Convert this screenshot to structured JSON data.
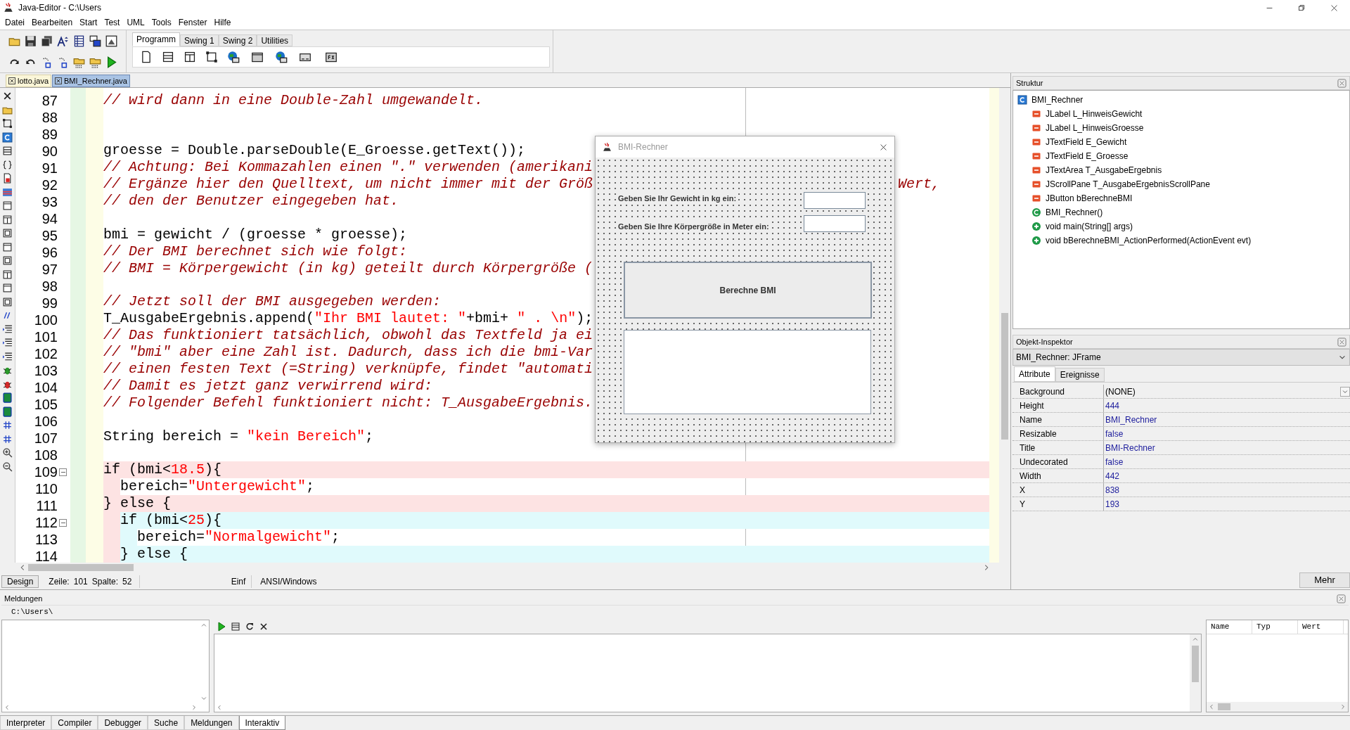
{
  "window": {
    "title": "Java-Editor - C:\\Users"
  },
  "menu": [
    "Datei",
    "Bearbeiten",
    "Start",
    "Test",
    "UML",
    "Tools",
    "Fenster",
    "Hilfe"
  ],
  "palette_tabs": [
    {
      "label": "Programm",
      "selected": true
    },
    {
      "label": "Swing 1",
      "selected": false
    },
    {
      "label": "Swing 2",
      "selected": false
    },
    {
      "label": "Utilities",
      "selected": false
    }
  ],
  "file_tabs": [
    {
      "label": "lotto.java",
      "selected": false
    },
    {
      "label": "BMI_Rechner.java",
      "selected": true
    }
  ],
  "editor": {
    "lines": [
      {
        "number": "87",
        "segments": [
          {
            "kind": "comment",
            "text": "// wird dann in eine Double-Zahl umgewandelt."
          }
        ]
      },
      {
        "number": "88"
      },
      {
        "number": "89"
      },
      {
        "number": "90",
        "segments": [
          {
            "kind": "plain",
            "text": "groesse = Double.parseDouble(E_Groesse.getText());"
          }
        ]
      },
      {
        "number": "91",
        "segments": [
          {
            "kind": "comment",
            "text": "// Achtung: Bei Kommazahlen einen \".\" verwenden (amerikani"
          }
        ]
      },
      {
        "number": "92",
        "segments": [
          {
            "kind": "comment",
            "text": "// Ergänze hier den Quelltext, um nicht immer mit der Größ"
          }
        ],
        "after_dialog": "Wert,"
      },
      {
        "number": "93",
        "segments": [
          {
            "kind": "comment",
            "text": "// den der Benutzer eingegeben hat."
          }
        ]
      },
      {
        "number": "94"
      },
      {
        "number": "95",
        "segments": [
          {
            "kind": "plain",
            "text": "bmi = gewicht / (groesse * groesse);"
          }
        ]
      },
      {
        "number": "96",
        "segments": [
          {
            "kind": "comment",
            "text": "// Der BMI berechnet sich wie folgt:"
          }
        ]
      },
      {
        "number": "97",
        "segments": [
          {
            "kind": "comment",
            "text": "// BMI = Körpergewicht (in kg) geteilt durch Körpergröße ("
          }
        ]
      },
      {
        "number": "98"
      },
      {
        "number": "99",
        "segments": [
          {
            "kind": "comment",
            "text": "// Jetzt soll der BMI ausgegeben werden:"
          }
        ]
      },
      {
        "number": "100",
        "segments": [
          {
            "kind": "plain",
            "text": "T_AusgabeErgebnis.append("
          },
          {
            "kind": "string",
            "text": "\"Ihr BMI lautet: \""
          },
          {
            "kind": "plain",
            "text": "+bmi+ "
          },
          {
            "kind": "string",
            "text": "\" . \\n\""
          },
          {
            "kind": "plain",
            "text": ");"
          }
        ]
      },
      {
        "number": "101",
        "segments": [
          {
            "kind": "comment",
            "text": "// Das funktioniert tatsächlich, obwohl das Textfeld ja ei"
          }
        ]
      },
      {
        "number": "102",
        "segments": [
          {
            "kind": "comment",
            "text": "// \"bmi\" aber eine Zahl ist. Dadurch, dass ich die bmi-Var"
          }
        ]
      },
      {
        "number": "103",
        "segments": [
          {
            "kind": "comment",
            "text": "// einen festen Text (=String) verknüpfe, findet \"automati"
          }
        ]
      },
      {
        "number": "104",
        "segments": [
          {
            "kind": "comment",
            "text": "// Damit es jetzt ganz verwirrend wird:"
          }
        ]
      },
      {
        "number": "105",
        "segments": [
          {
            "kind": "comment",
            "text": "// Folgender Befehl funktioniert nicht: T_AusgabeErgebnis."
          }
        ]
      },
      {
        "number": "106"
      },
      {
        "number": "107",
        "segments": [
          {
            "kind": "plain",
            "text": "String bereich = "
          },
          {
            "kind": "string",
            "text": "\"kein Bereich\""
          },
          {
            "kind": "plain",
            "text": ";"
          }
        ]
      },
      {
        "number": "108"
      },
      {
        "number": "109",
        "fold": true,
        "bands": [
          {
            "color": "#fde3e3"
          }
        ],
        "in_body": false,
        "segments": [
          {
            "kind": "plain",
            "text": "if (bmi<"
          },
          {
            "kind": "number",
            "text": "18.5"
          },
          {
            "kind": "plain",
            "text": "){"
          }
        ]
      },
      {
        "number": "110",
        "fold": false,
        "bands": [
          {
            "color": "#fde3e3"
          }
        ],
        "in_body": true,
        "segments": [
          {
            "kind": "plain",
            "text": "  bereich="
          },
          {
            "kind": "string",
            "text": "\"Untergewicht\""
          },
          {
            "kind": "plain",
            "text": ";"
          }
        ]
      },
      {
        "number": "111",
        "fold": false,
        "bands": [
          {
            "color": "#fde3e3"
          }
        ],
        "in_body": false,
        "segments": [
          {
            "kind": "plain",
            "text": "} else {"
          }
        ]
      },
      {
        "number": "112",
        "fold": true,
        "bands": [
          {
            "color": "#fde3e3"
          },
          {
            "color": "#e0fafc"
          }
        ],
        "in_body": false,
        "segments": [
          {
            "kind": "plain",
            "text": "  if (bmi<"
          },
          {
            "kind": "number",
            "text": "25"
          },
          {
            "kind": "plain",
            "text": "){"
          }
        ]
      },
      {
        "number": "113",
        "fold": false,
        "bands": [
          {
            "color": "#fde3e3"
          },
          {
            "color": "#e0fafc"
          }
        ],
        "in_body": true,
        "segments": [
          {
            "kind": "plain",
            "text": "    bereich="
          },
          {
            "kind": "string",
            "text": "\"Normalgewicht\""
          },
          {
            "kind": "plain",
            "text": ";"
          }
        ]
      },
      {
        "number": "114",
        "fold": false,
        "bands": [
          {
            "color": "#fde3e3"
          },
          {
            "color": "#e0fafc"
          }
        ],
        "in_body": false,
        "segments": [
          {
            "kind": "plain",
            "text": "  } else {"
          }
        ]
      }
    ]
  },
  "dialog": {
    "title": "BMI-Rechner",
    "labels": [
      "Geben Sie Ihr Gewicht in kg ein:",
      "Geben Sie Ihre Körpergröße in Meter ein:"
    ],
    "button": "Berechne BMI"
  },
  "status_bar": {
    "design": "Design",
    "line_label": "Zeile:",
    "line": "101",
    "column_label": "Spalte:",
    "column": "52",
    "mode": "Einf",
    "encoding": "ANSI/Windows"
  },
  "structure": {
    "title": "Struktur",
    "tree": [
      {
        "label": "BMI_Rechner",
        "kind": "class",
        "children": [
          {
            "label": "JLabel L_HinweisGewicht",
            "kind": "field"
          },
          {
            "label": "JLabel L_HinweisGroesse",
            "kind": "field"
          },
          {
            "label": "JTextField E_Gewicht",
            "kind": "field"
          },
          {
            "label": "JTextField E_Groesse",
            "kind": "field"
          },
          {
            "label": "JTextArea T_AusgabeErgebnis",
            "kind": "field"
          },
          {
            "label": "JScrollPane T_AusgabeErgebnisScrollPane",
            "kind": "field"
          },
          {
            "label": "JButton bBerechneBMI",
            "kind": "field"
          },
          {
            "label": "BMI_Rechner()",
            "kind": "constructor"
          },
          {
            "label": "void main(String[] args)",
            "kind": "method"
          },
          {
            "label": "void bBerechneBMI_ActionPerformed(ActionEvent evt)",
            "kind": "method"
          }
        ]
      }
    ]
  },
  "inspector": {
    "title": "Objekt-Inspektor",
    "object": "BMI_Rechner: JFrame",
    "tabs": [
      {
        "label": "Attribute",
        "selected": true
      },
      {
        "label": "Ereignisse",
        "selected": false
      }
    ],
    "properties": [
      {
        "name": "Background",
        "value": "(NONE)",
        "kind": "choice"
      },
      {
        "name": "Height",
        "value": "444",
        "kind": "text"
      },
      {
        "name": "Name",
        "value": "BMI_Rechner",
        "kind": "text"
      },
      {
        "name": "Resizable",
        "value": "false",
        "kind": "text"
      },
      {
        "name": "Title",
        "value": "BMI-Rechner",
        "kind": "text"
      },
      {
        "name": "Undecorated",
        "value": "false",
        "kind": "text"
      },
      {
        "name": "Width",
        "value": "442",
        "kind": "text"
      },
      {
        "name": "X",
        "value": "838",
        "kind": "text"
      },
      {
        "name": "Y",
        "value": "193",
        "kind": "text"
      }
    ],
    "more_button": "Mehr"
  },
  "messages": {
    "title": "Meldungen",
    "path": "C:\\Users\\",
    "variables_columns": [
      "Name",
      "Typ",
      "Wert"
    ]
  },
  "bottom_tabs": [
    {
      "label": "Interpreter",
      "selected": false
    },
    {
      "label": "Compiler",
      "selected": false
    },
    {
      "label": "Debugger",
      "selected": false
    },
    {
      "label": "Suche",
      "selected": false
    },
    {
      "label": "Meldungen",
      "selected": false
    },
    {
      "label": "Interaktiv",
      "selected": true
    }
  ]
}
